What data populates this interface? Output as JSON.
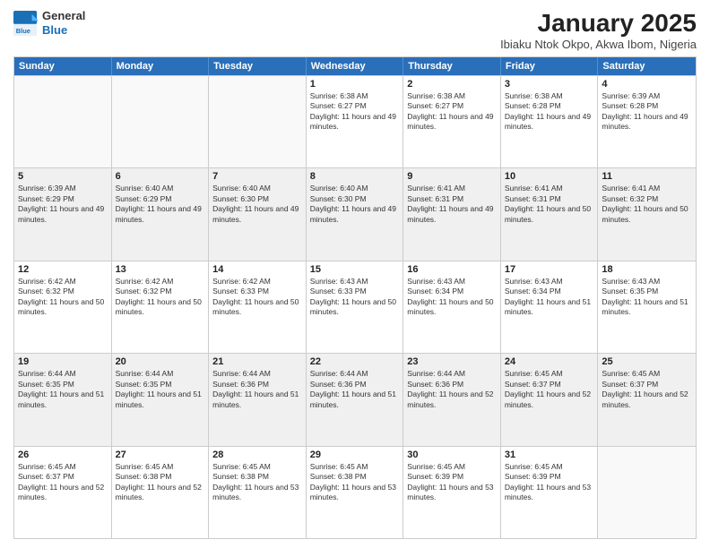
{
  "logo": {
    "general": "General",
    "blue": "Blue"
  },
  "header": {
    "month": "January 2025",
    "location": "Ibiaku Ntok Okpo, Akwa Ibom, Nigeria"
  },
  "days": [
    "Sunday",
    "Monday",
    "Tuesday",
    "Wednesday",
    "Thursday",
    "Friday",
    "Saturday"
  ],
  "rows": [
    [
      {
        "day": "",
        "empty": true
      },
      {
        "day": "",
        "empty": true
      },
      {
        "day": "",
        "empty": true
      },
      {
        "day": "1",
        "sunrise": "6:38 AM",
        "sunset": "6:27 PM",
        "daylight": "11 hours and 49 minutes."
      },
      {
        "day": "2",
        "sunrise": "6:38 AM",
        "sunset": "6:27 PM",
        "daylight": "11 hours and 49 minutes."
      },
      {
        "day": "3",
        "sunrise": "6:38 AM",
        "sunset": "6:28 PM",
        "daylight": "11 hours and 49 minutes."
      },
      {
        "day": "4",
        "sunrise": "6:39 AM",
        "sunset": "6:28 PM",
        "daylight": "11 hours and 49 minutes."
      }
    ],
    [
      {
        "day": "5",
        "sunrise": "6:39 AM",
        "sunset": "6:29 PM",
        "daylight": "11 hours and 49 minutes."
      },
      {
        "day": "6",
        "sunrise": "6:40 AM",
        "sunset": "6:29 PM",
        "daylight": "11 hours and 49 minutes."
      },
      {
        "day": "7",
        "sunrise": "6:40 AM",
        "sunset": "6:30 PM",
        "daylight": "11 hours and 49 minutes."
      },
      {
        "day": "8",
        "sunrise": "6:40 AM",
        "sunset": "6:30 PM",
        "daylight": "11 hours and 49 minutes."
      },
      {
        "day": "9",
        "sunrise": "6:41 AM",
        "sunset": "6:31 PM",
        "daylight": "11 hours and 49 minutes."
      },
      {
        "day": "10",
        "sunrise": "6:41 AM",
        "sunset": "6:31 PM",
        "daylight": "11 hours and 50 minutes."
      },
      {
        "day": "11",
        "sunrise": "6:41 AM",
        "sunset": "6:32 PM",
        "daylight": "11 hours and 50 minutes."
      }
    ],
    [
      {
        "day": "12",
        "sunrise": "6:42 AM",
        "sunset": "6:32 PM",
        "daylight": "11 hours and 50 minutes."
      },
      {
        "day": "13",
        "sunrise": "6:42 AM",
        "sunset": "6:32 PM",
        "daylight": "11 hours and 50 minutes."
      },
      {
        "day": "14",
        "sunrise": "6:42 AM",
        "sunset": "6:33 PM",
        "daylight": "11 hours and 50 minutes."
      },
      {
        "day": "15",
        "sunrise": "6:43 AM",
        "sunset": "6:33 PM",
        "daylight": "11 hours and 50 minutes."
      },
      {
        "day": "16",
        "sunrise": "6:43 AM",
        "sunset": "6:34 PM",
        "daylight": "11 hours and 50 minutes."
      },
      {
        "day": "17",
        "sunrise": "6:43 AM",
        "sunset": "6:34 PM",
        "daylight": "11 hours and 51 minutes."
      },
      {
        "day": "18",
        "sunrise": "6:43 AM",
        "sunset": "6:35 PM",
        "daylight": "11 hours and 51 minutes."
      }
    ],
    [
      {
        "day": "19",
        "sunrise": "6:44 AM",
        "sunset": "6:35 PM",
        "daylight": "11 hours and 51 minutes."
      },
      {
        "day": "20",
        "sunrise": "6:44 AM",
        "sunset": "6:35 PM",
        "daylight": "11 hours and 51 minutes."
      },
      {
        "day": "21",
        "sunrise": "6:44 AM",
        "sunset": "6:36 PM",
        "daylight": "11 hours and 51 minutes."
      },
      {
        "day": "22",
        "sunrise": "6:44 AM",
        "sunset": "6:36 PM",
        "daylight": "11 hours and 51 minutes."
      },
      {
        "day": "23",
        "sunrise": "6:44 AM",
        "sunset": "6:36 PM",
        "daylight": "11 hours and 52 minutes."
      },
      {
        "day": "24",
        "sunrise": "6:45 AM",
        "sunset": "6:37 PM",
        "daylight": "11 hours and 52 minutes."
      },
      {
        "day": "25",
        "sunrise": "6:45 AM",
        "sunset": "6:37 PM",
        "daylight": "11 hours and 52 minutes."
      }
    ],
    [
      {
        "day": "26",
        "sunrise": "6:45 AM",
        "sunset": "6:37 PM",
        "daylight": "11 hours and 52 minutes."
      },
      {
        "day": "27",
        "sunrise": "6:45 AM",
        "sunset": "6:38 PM",
        "daylight": "11 hours and 52 minutes."
      },
      {
        "day": "28",
        "sunrise": "6:45 AM",
        "sunset": "6:38 PM",
        "daylight": "11 hours and 53 minutes."
      },
      {
        "day": "29",
        "sunrise": "6:45 AM",
        "sunset": "6:38 PM",
        "daylight": "11 hours and 53 minutes."
      },
      {
        "day": "30",
        "sunrise": "6:45 AM",
        "sunset": "6:39 PM",
        "daylight": "11 hours and 53 minutes."
      },
      {
        "day": "31",
        "sunrise": "6:45 AM",
        "sunset": "6:39 PM",
        "daylight": "11 hours and 53 minutes."
      },
      {
        "day": "",
        "empty": true
      }
    ]
  ],
  "labels": {
    "sunrise_prefix": "Sunrise: ",
    "sunset_prefix": "Sunset: ",
    "daylight_prefix": "Daylight: "
  }
}
